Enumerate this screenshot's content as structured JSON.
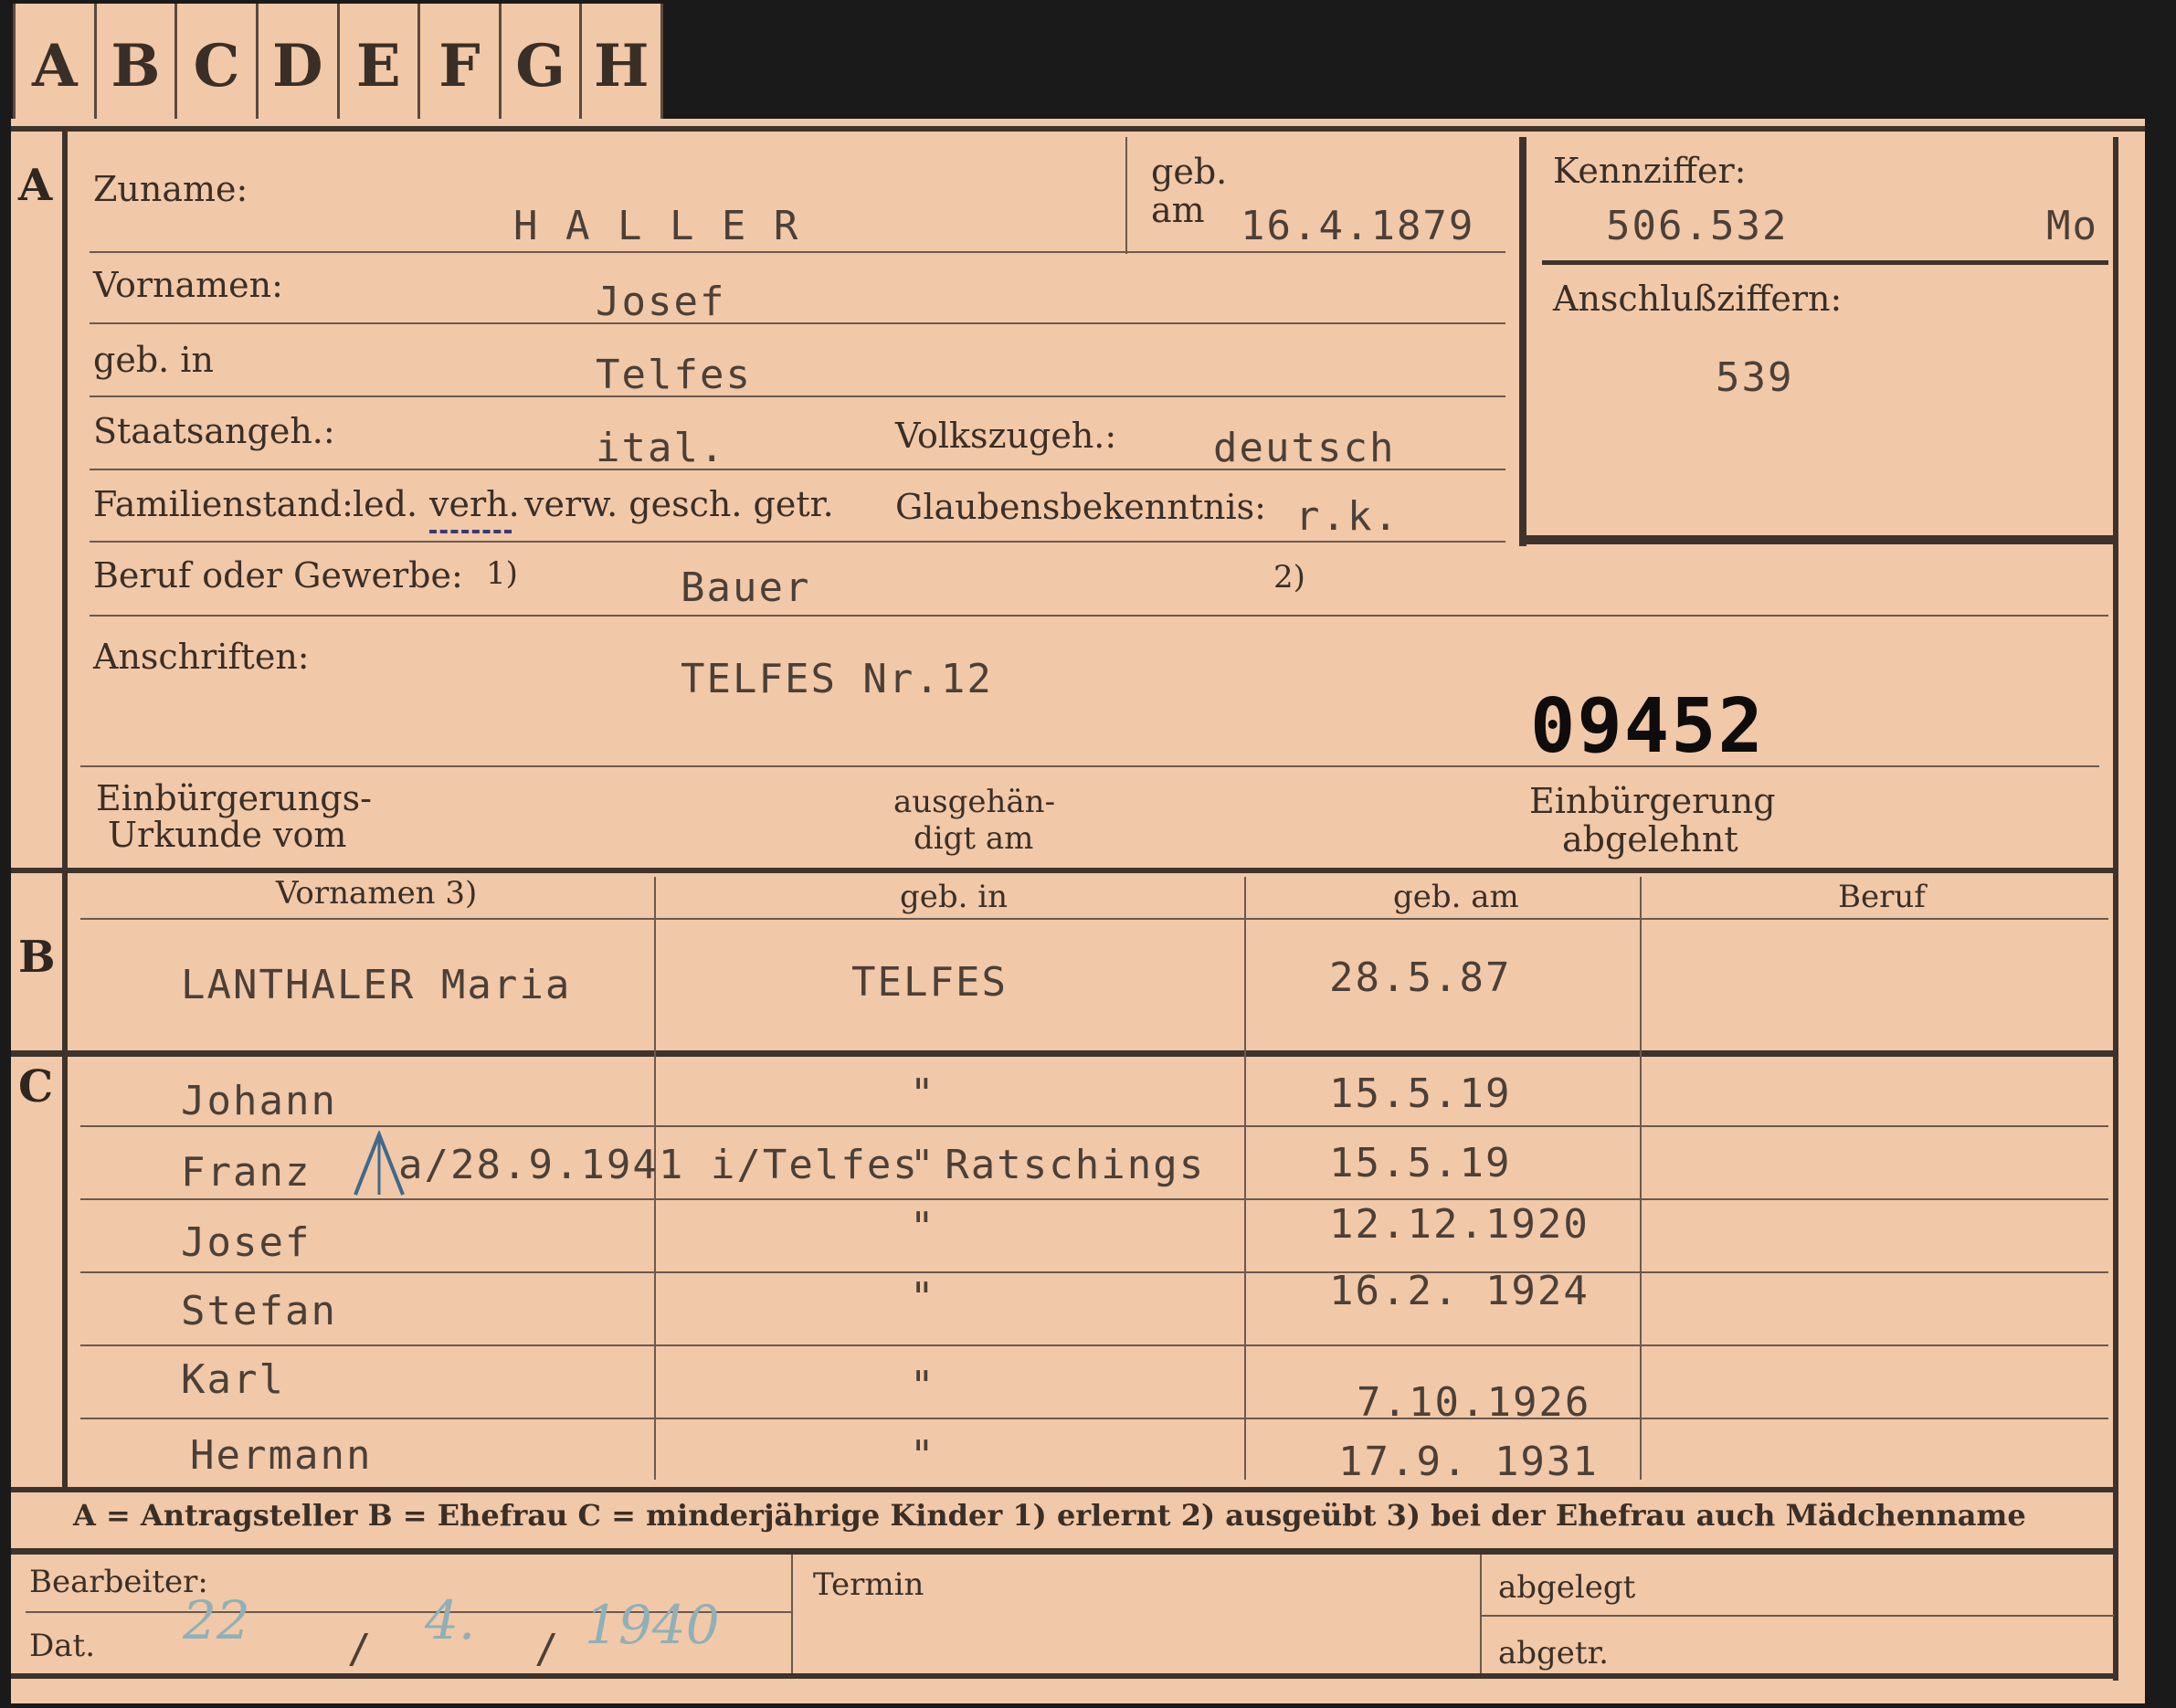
{
  "tabs": [
    "A",
    "B",
    "C",
    "D",
    "E",
    "F",
    "G",
    "H"
  ],
  "section_a": {
    "marker": "A",
    "zuname_label": "Zuname:",
    "zuname_value": "H A L L E R",
    "geb_label_1": "geb.",
    "geb_label_2": "am",
    "geb_value": "16.4.1879",
    "kennziffer_label": "Kennziffer:",
    "kennziffer_value": "506.532",
    "kennziffer_suffix": "Mo",
    "vornamen_label": "Vornamen:",
    "vornamen_value": "Josef",
    "anschluss_label": "Anschlußziffern:",
    "anschluss_value": "539",
    "gebin_label": "geb. in",
    "gebin_value": "Telfes",
    "staats_label": "Staatsangeh.:",
    "staats_value": "ital.",
    "volks_label": "Volkszugeh.:",
    "volks_value": "deutsch",
    "familien_label": "Familienstand:",
    "fam_led": "led.",
    "fam_verh": "verh.",
    "fam_rest": "verw. gesch. getr.",
    "glaubens_label": "Glaubensbekenntnis:",
    "glaubens_value": "r.k.",
    "beruf_label": "Beruf oder Gewerbe:",
    "fn1": "1)",
    "fn2": "2)",
    "beruf_value": "Bauer",
    "anschriften_label": "Anschriften:",
    "anschriften_value": "TELFES Nr.12",
    "stamp": "09452",
    "einb_label_1": "Einbürgerungs-",
    "einb_label_2": "Urkunde vom",
    "ausg_label_1": "ausgehän-",
    "ausg_label_2": "digt am",
    "abgel_label_1": "Einbürgerung",
    "abgel_label_2": "abgelehnt"
  },
  "section_b": {
    "marker": "B",
    "headers": [
      "Vornamen 3)",
      "geb. in",
      "geb. am",
      "Beruf"
    ],
    "row": [
      "LANTHALER Maria",
      "TELFES",
      "28.5.87",
      ""
    ]
  },
  "section_c": {
    "marker": "C",
    "rows": [
      {
        "name": "Johann",
        "place": "\"",
        "date": "15.5.19"
      },
      {
        "name": "Franz",
        "place": "\"",
        "date": "15.5.19"
      },
      {
        "name": "Josef",
        "place": "\"",
        "date": "12.12.1920"
      },
      {
        "name": "Stefan",
        "place": "\"",
        "date": "16.2. 1924"
      },
      {
        "name": "Karl",
        "place": "\"",
        "date": "7.10.1926"
      },
      {
        "name": "Hermann",
        "place": "\"",
        "date": "17.9. 1931"
      }
    ],
    "death_note": "a/28.9.1941 i/Telfes Ratschings"
  },
  "legend": "A = Antragsteller   B = Ehefrau   C = minderjährige Kinder   1) erlernt   2) ausgeübt   3) bei der Ehefrau auch Mädchenname",
  "footer": {
    "bearbeiter_label": "Bearbeiter:",
    "dat_label": "Dat.",
    "date_day": "22",
    "date_month": "4.",
    "date_year": "1940",
    "slash": "/",
    "termin_label": "Termin",
    "abgelegt_label": "abgelegt",
    "abgetr_label": "abgetr."
  }
}
